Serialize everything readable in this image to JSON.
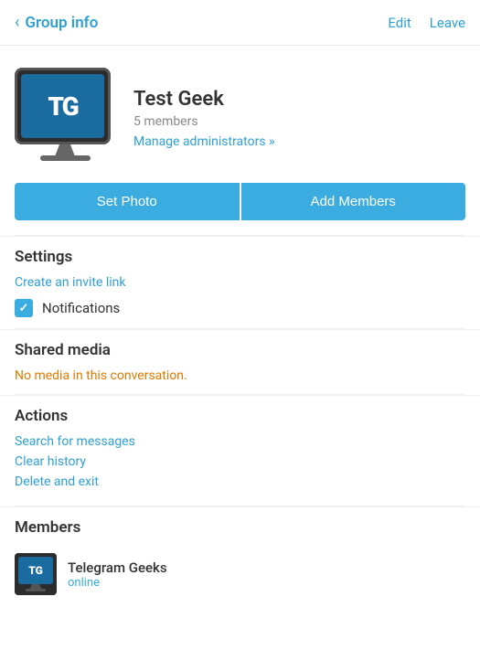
{
  "header": {
    "back_label": "Group info",
    "edit_label": "Edit",
    "leave_label": "Leave"
  },
  "profile": {
    "group_name": "Test Geek",
    "member_count": "5 members",
    "manage_admin_label": "Manage administrators »"
  },
  "buttons": {
    "set_photo": "Set Photo",
    "add_members": "Add Members"
  },
  "settings": {
    "section_title": "Settings",
    "invite_link_label": "Create an invite link",
    "notifications_label": "Notifications"
  },
  "shared_media": {
    "section_title": "Shared media",
    "empty_note": "No media in this conversation."
  },
  "actions": {
    "section_title": "Actions",
    "search_label": "Search for messages",
    "clear_label": "Clear history",
    "delete_label": "Delete and exit"
  },
  "members": {
    "section_title": "Members",
    "list": [
      {
        "name": "Telegram Geeks",
        "status": "online"
      }
    ]
  }
}
